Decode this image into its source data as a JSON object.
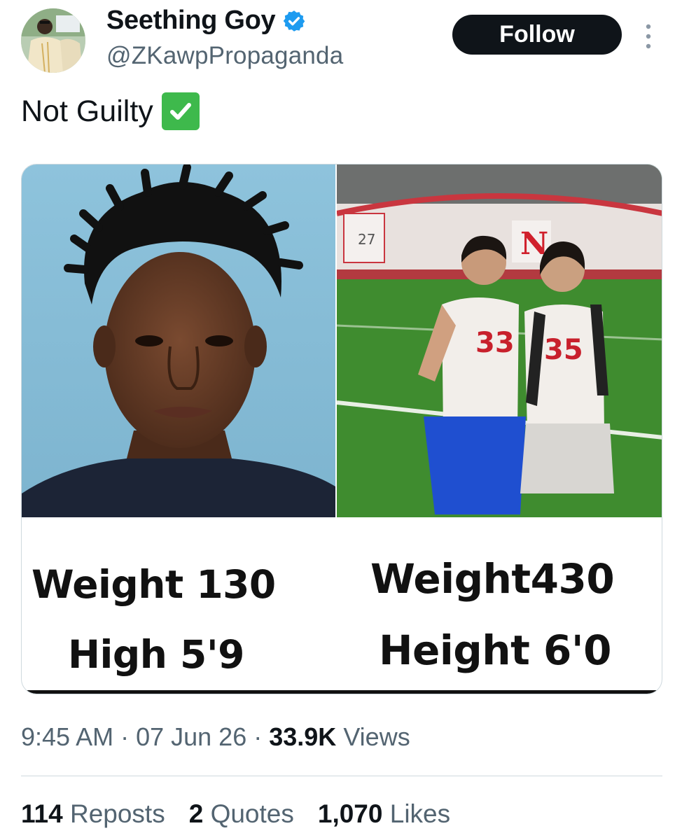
{
  "author": {
    "display_name": "Seething Goy",
    "handle": "@ZKawpPropaganda",
    "verified": true,
    "verified_icon": "verified-badge-icon",
    "avatar_icon": "avatar"
  },
  "actions": {
    "follow_label": "Follow",
    "more_icon": "more-vertical-icon"
  },
  "tweet": {
    "text": "Not Guilty",
    "emoji": "check-mark-button-emoji"
  },
  "media": {
    "left_photo": {
      "caption_weight": "Weight 130",
      "caption_height": "High 5'9"
    },
    "right_photo": {
      "jersey_numbers": [
        "33",
        "35"
      ],
      "banner_letter": "N",
      "banner_number": "27",
      "caption_weight": "Weight430",
      "caption_height": "Height 6'0"
    }
  },
  "meta": {
    "time": "9:45 AM",
    "sep1": " · ",
    "date": "07 Jun 26",
    "sep2": " · ",
    "views_count": "33.9K",
    "views_label": " Views"
  },
  "stats": {
    "reposts_count": "114",
    "reposts_label": " Reposts",
    "quotes_count": "2",
    "quotes_label": " Quotes",
    "likes_count": "1,070",
    "likes_label": " Likes"
  },
  "colors": {
    "accent_verified": "#1d9bf0",
    "follow_bg": "#0f1419",
    "secondary_text": "#536471"
  }
}
